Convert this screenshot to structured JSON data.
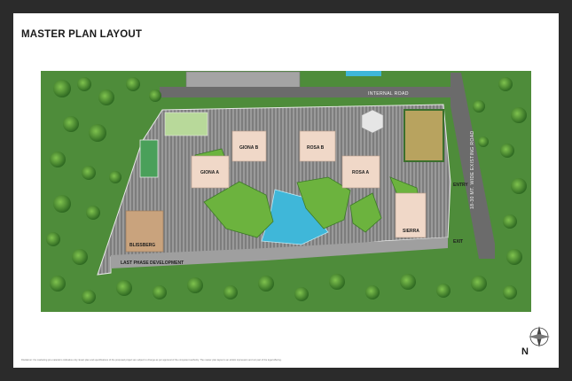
{
  "title": "MASTER PLAN LAYOUT",
  "labels": {
    "internal_road": "INTERNAL ROAD",
    "existing_road": "18-30 MT. WIDE EXISTING ROAD",
    "entry": "ENTRY",
    "exit": "EXIT",
    "giona_b": "GIONA B",
    "rosa_b": "ROSA B",
    "giona_a": "GIONA A",
    "rosa_a": "ROSA A",
    "sierra": "SIERRA",
    "blissberg": "BLISSBERG",
    "last_phase": "LAST PHASE DEVELOPMENT"
  },
  "compass": {
    "letter": "N"
  },
  "disclaimer": "Disclaimer: the marketing pro-material is indicative only. Exact plan and specifications of the proposed project are subject to change as per approval of the competent authority. The master plan layout is an artistic impression and not part of the legal offering.",
  "colors": {
    "frame": "#2b2b2b",
    "grass": "#4e8c3a",
    "site_floor": "#8a8a8a",
    "road": "#6b6b6b",
    "building": "#f0d8c8",
    "pool": "#3fb7d9",
    "landscape_mound": "#6cb33e",
    "court": "#b8a35f"
  }
}
